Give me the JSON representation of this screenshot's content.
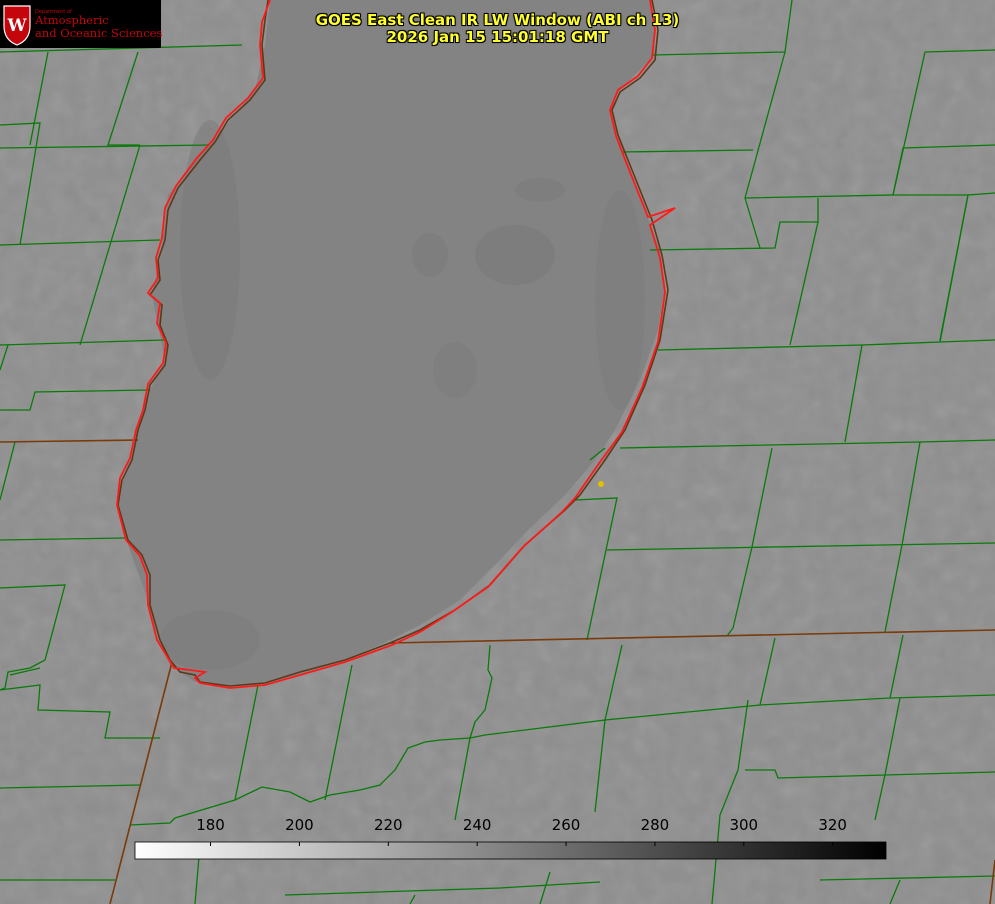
{
  "header": {
    "title_line1": "GOES East Clean IR LW Window (ABI ch 13)",
    "title_line2": "2026 Jan 15 15:01:18 GMT",
    "title_color": "#ffff2e"
  },
  "logo": {
    "department": "Department of",
    "name_line1": "Atmospheric",
    "name_line2": "and Oceanic Sciences",
    "seal_letter": "W",
    "brand_color": "#c5050c"
  },
  "colorbar": {
    "ticks": [
      180,
      200,
      220,
      240,
      260,
      280,
      300,
      320
    ],
    "range": [
      163,
      332
    ],
    "colormap": "white (cold) to black (warm) grayscale",
    "start_color": "#ffffff",
    "end_color": "#000000"
  },
  "map": {
    "background_color": "#8d8d8d",
    "lake_fill_color": "#858585",
    "county_boundary_color": "#0a7a0a",
    "coastline_color": "#ff1a1a",
    "state_boundary_color": "#7a3a0a",
    "site_marker_color": "#e0c000"
  }
}
